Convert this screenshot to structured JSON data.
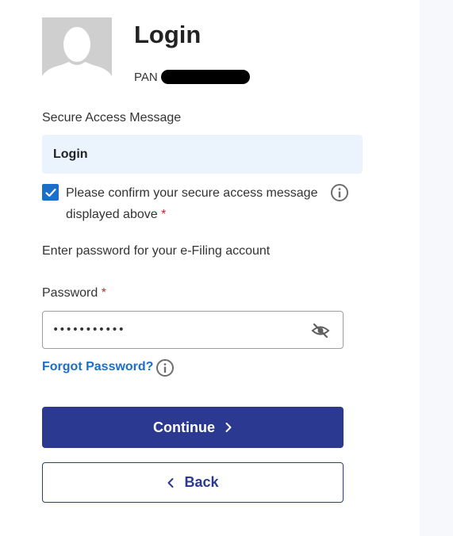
{
  "header": {
    "title": "Login",
    "pan_label": "PAN"
  },
  "secure_access": {
    "label": "Secure Access Message",
    "message": "Login",
    "confirm_checked": true,
    "confirm_text": "Please confirm your secure access message displayed above",
    "required_mark": "*"
  },
  "password_section": {
    "intro": "Enter password for your e-Filing account",
    "label": "Password",
    "required_mark": "*",
    "masked_value": "•••••••••••",
    "forgot_link": "Forgot Password?"
  },
  "actions": {
    "continue_label": "Continue",
    "back_label": "Back"
  },
  "icons": {
    "avatar": "user-silhouette-icon",
    "checkbox": "check-icon",
    "info": "info-icon",
    "visibility": "eye-off-icon",
    "continue": "chevron-right-icon",
    "back": "chevron-left-icon"
  },
  "colors": {
    "primary": "#2b3990",
    "link": "#1a6fc9",
    "required": "#c62828",
    "message_bg": "#ebf3fd"
  }
}
